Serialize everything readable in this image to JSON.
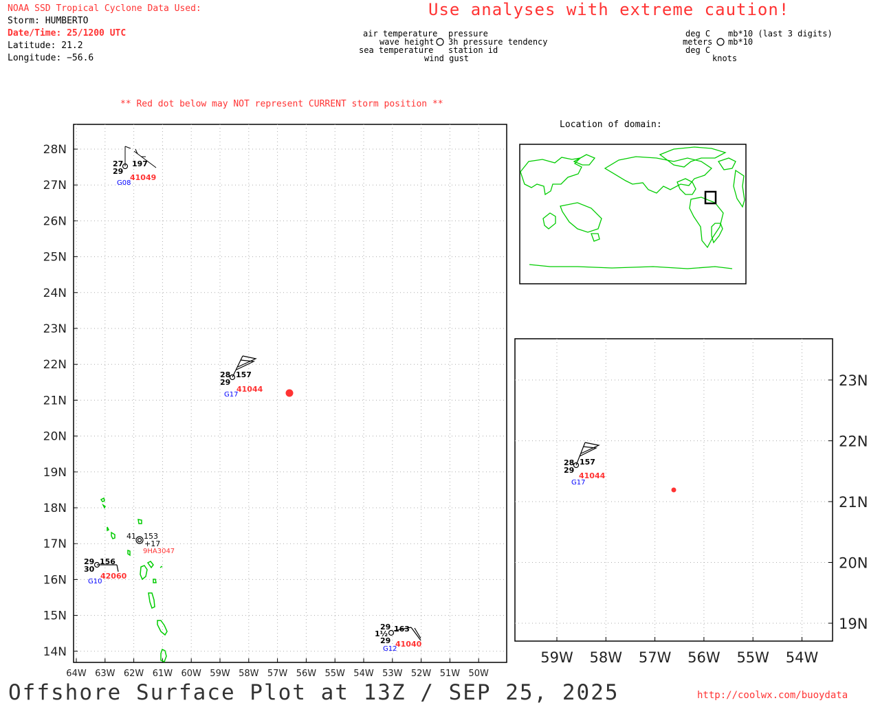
{
  "header": {
    "source": "NOAA SSD Tropical Cyclone Data Used:",
    "storm": "Storm: HUMBERTO",
    "datetime": "Date/Time: 25/1200 UTC",
    "latitude": "Latitude: 21.2",
    "longitude": "Longitude: −56.6",
    "caution": "Use analyses with extreme caution!",
    "red_dot_note": "** Red dot below may NOT represent CURRENT storm position **"
  },
  "legend": {
    "left": [
      "air temperature",
      "wave height",
      "sea temperature"
    ],
    "right": [
      "pressure",
      "3h pressure tendency",
      "station id"
    ],
    "bottom": "wind gust",
    "units_left": [
      "deg C",
      "meters",
      "deg C"
    ],
    "units_right": [
      "mb*10 (last 3 digits)",
      "mb*10"
    ],
    "units_bottom": "knots"
  },
  "inset": {
    "title": "Location of domain:"
  },
  "footer": {
    "title": "Offshore Surface Plot at 13Z / SEP 25, 2025",
    "url": "http://coolwx.com/buoydata"
  },
  "colors": {
    "coast": "#00cc00",
    "alert": "#ff3333",
    "station_id": "#ff3333",
    "gust": "#0000ff",
    "grid": "#aaaaaa"
  },
  "main_map": {
    "lat_labels": [
      "28N",
      "27N",
      "26N",
      "25N",
      "24N",
      "23N",
      "22N",
      "21N",
      "20N",
      "19N",
      "18N",
      "17N",
      "16N",
      "15N",
      "14N"
    ],
    "lon_labels": [
      "64W",
      "63W",
      "62W",
      "61W",
      "60W",
      "59W",
      "58W",
      "57W",
      "56W",
      "55W",
      "54W",
      "53W",
      "52W",
      "51W",
      "50W"
    ],
    "storm_position": {
      "lat": 21.2,
      "lon": -56.6
    }
  },
  "zoom_map": {
    "lat_labels": [
      "23N",
      "22N",
      "21N",
      "20N",
      "19N"
    ],
    "lon_labels": [
      "59W",
      "58W",
      "57W",
      "56W",
      "55W",
      "54W"
    ]
  },
  "stations": [
    {
      "id": "41049",
      "air": "27",
      "sea": "29",
      "pressure": "197",
      "gust": "G08",
      "lat": 27.2,
      "lon": -62.3
    },
    {
      "id": "41044",
      "air": "28",
      "sea": "29",
      "pressure": "157",
      "gust": "G17",
      "lat": 21.6,
      "lon": -58.6
    },
    {
      "id": "9HA3047",
      "air": "41",
      "pressure": "153",
      "tendency": "+17",
      "lat": 17.1,
      "lon": -61.8
    },
    {
      "id": "42060",
      "air": "29",
      "sea": "30",
      "pressure": "156",
      "gust": "G10",
      "lat": 16.4,
      "lon": -63.2
    },
    {
      "id": "41040",
      "air": "29",
      "wave": "1½",
      "sea": "29",
      "pressure": "163",
      "gust": "G12",
      "lat": 14.5,
      "lon": -53.0
    }
  ]
}
